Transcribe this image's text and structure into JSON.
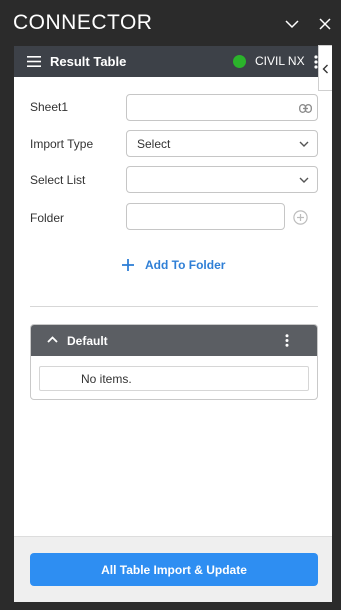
{
  "app": {
    "title": "CONNECTOR"
  },
  "header": {
    "title": "Result Table",
    "connection_label": "CIVIL NX",
    "status_color": "#2bb32b"
  },
  "form": {
    "sheet": {
      "label": "Sheet1",
      "value": ""
    },
    "import_type": {
      "label": "Import Type",
      "value": "Select"
    },
    "select_list": {
      "label": "Select List",
      "value": ""
    },
    "folder": {
      "label": "Folder",
      "value": ""
    }
  },
  "add_folder": {
    "label": "Add To Folder"
  },
  "group": {
    "title": "Default",
    "empty_text": "No items."
  },
  "footer": {
    "button_label": "All Table Import & Update"
  },
  "colors": {
    "accent": "#2e8ef2",
    "link": "#2f7fd6",
    "header_bg": "#3d4148",
    "group_header_bg": "#5b5e63"
  },
  "icons": [
    "chevron-down-icon",
    "close-icon",
    "hamburger-icon",
    "kebab-icon",
    "chevron-left-icon",
    "link-icon",
    "plus-circle-icon",
    "plus-icon",
    "chevron-up-icon"
  ]
}
